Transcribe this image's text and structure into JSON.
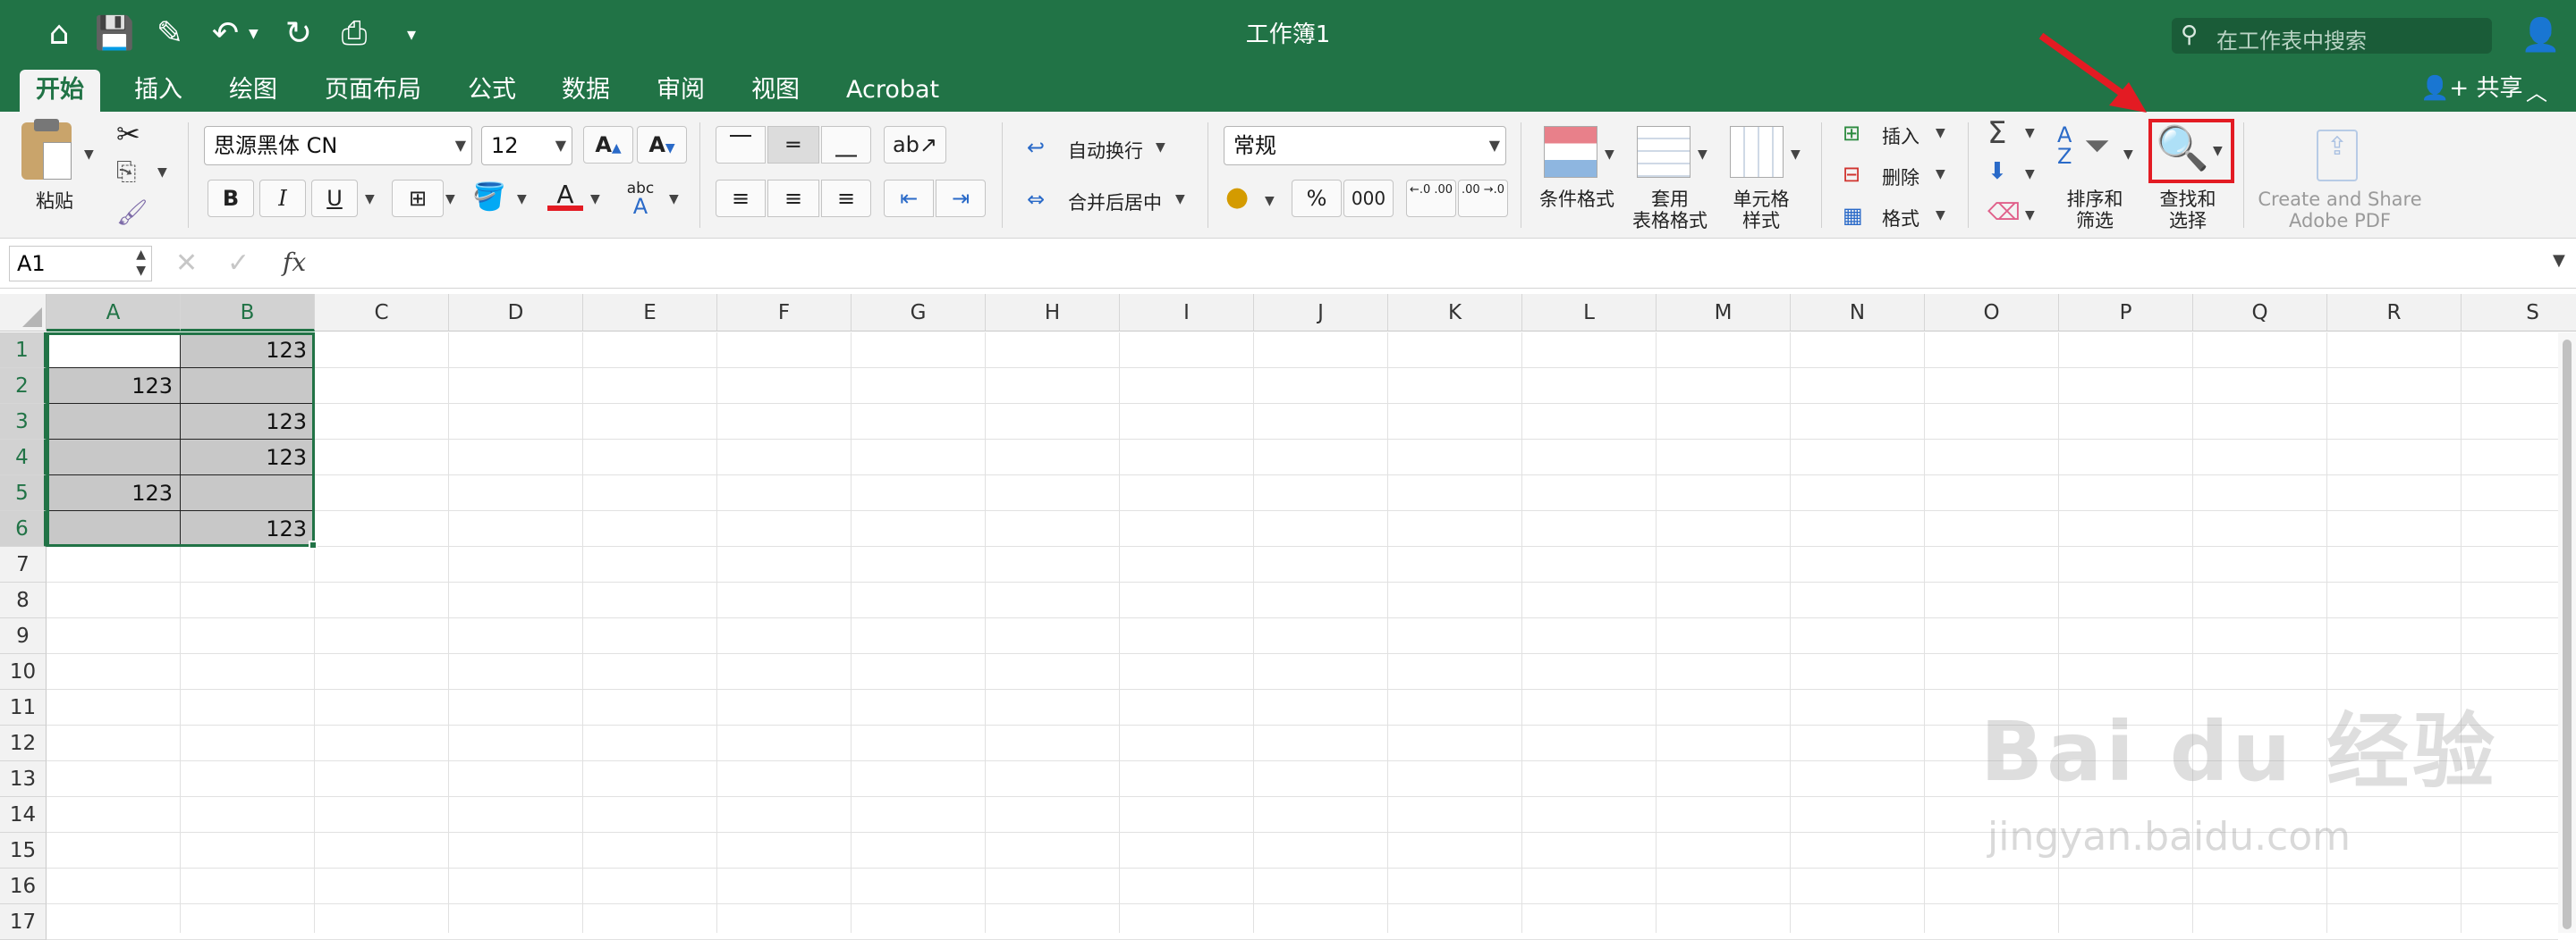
{
  "window": {
    "title": "工作簿1"
  },
  "search": {
    "placeholder": "在工作表中搜索"
  },
  "quick_access": {
    "icons": [
      "home-icon",
      "save-icon",
      "edit-icon",
      "undo-icon",
      "redo-icon",
      "print-icon",
      "customize-icon"
    ]
  },
  "tabs": [
    "开始",
    "插入",
    "绘图",
    "页面布局",
    "公式",
    "数据",
    "审阅",
    "视图",
    "Acrobat"
  ],
  "share_label": "共享",
  "ribbon": {
    "paste_label": "粘贴",
    "font_name": "思源黑体 CN",
    "font_size": "12",
    "wrap_text": "自动换行",
    "merge_center": "合并后居中",
    "number_format": "常规",
    "percent": "%",
    "thousands": "000",
    "dec_increase": "←.0 .00",
    "dec_decrease": ".00 →.0",
    "cond_format": "条件格式",
    "table_format_1": "套用",
    "table_format_2": "表格格式",
    "cell_style_1": "单元格",
    "cell_style_2": "样式",
    "insert": "插入",
    "delete": "删除",
    "format": "格式",
    "sort_filter_1": "排序和",
    "sort_filter_2": "筛选",
    "find_select_1": "查找和",
    "find_select_2": "选择",
    "acrobat_1": "Create and Share",
    "acrobat_2": "Adobe PDF",
    "bold": "B",
    "italic": "I",
    "underline": "U"
  },
  "formula_bar": {
    "name_box": "A1",
    "fx": "fx",
    "content": ""
  },
  "columns": [
    "A",
    "B",
    "C",
    "D",
    "E",
    "F",
    "G",
    "H",
    "I",
    "J",
    "K",
    "L",
    "M",
    "N",
    "O",
    "P",
    "Q",
    "R",
    "S"
  ],
  "rows": [
    "1",
    "2",
    "3",
    "4",
    "5",
    "6",
    "7",
    "8",
    "9",
    "10",
    "11",
    "12",
    "13",
    "14",
    "15",
    "16",
    "17"
  ],
  "cells": {
    "B1": "123",
    "A2": "123",
    "B3": "123",
    "B4": "123",
    "A5": "123",
    "B6": "123"
  },
  "watermark": {
    "brand": "Bai du 经验",
    "url": "jingyan.baidu.com"
  },
  "accent_color": "#217346",
  "highlight_color": "#e31b23"
}
